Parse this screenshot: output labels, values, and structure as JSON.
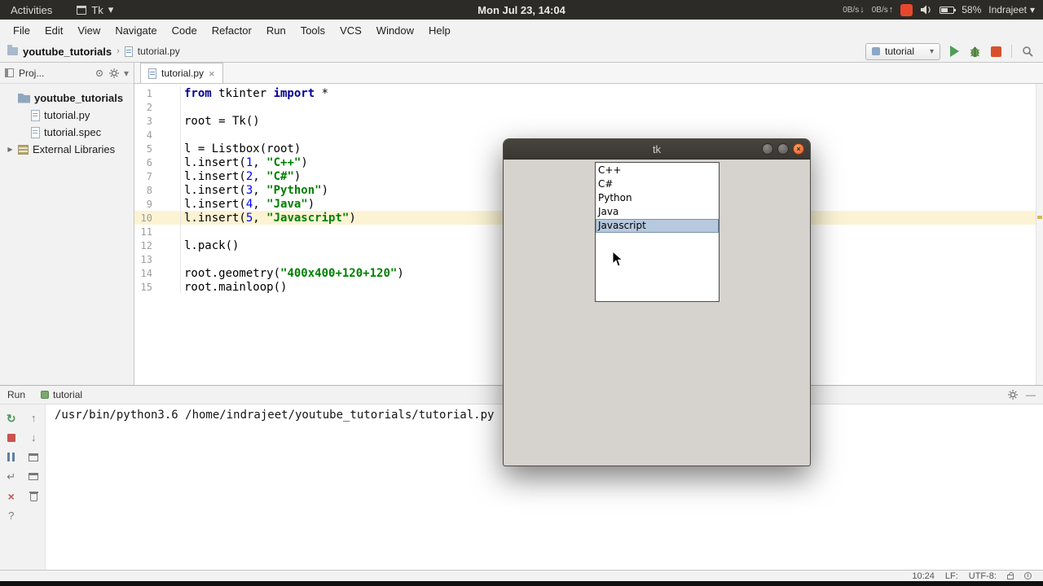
{
  "top_bar": {
    "activities": "Activities",
    "window_name": "Tk",
    "clock": "Mon Jul 23, 14:04",
    "net_down": "0B/s",
    "net_up": "0B/s",
    "battery_percent": "58%",
    "user": "Indrajeet"
  },
  "menu_bar": {
    "items": [
      "File",
      "Edit",
      "View",
      "Navigate",
      "Code",
      "Refactor",
      "Run",
      "Tools",
      "VCS",
      "Window",
      "Help"
    ]
  },
  "nav_bar": {
    "breadcrumb": [
      "youtube_tutorials",
      "tutorial.py"
    ],
    "run_config": "tutorial"
  },
  "project_panel": {
    "header_label": "Proj...",
    "tree": [
      {
        "label": "youtube_tutorials",
        "icon": "folder",
        "bold": true,
        "indent": 0,
        "arrow": ""
      },
      {
        "label": "tutorial.py",
        "icon": "file",
        "bold": false,
        "indent": 1,
        "arrow": ""
      },
      {
        "label": "tutorial.spec",
        "icon": "file",
        "bold": false,
        "indent": 1,
        "arrow": ""
      },
      {
        "label": "External Libraries",
        "icon": "library",
        "bold": false,
        "indent": 0,
        "arrow": "▶"
      }
    ]
  },
  "editor": {
    "tab_label": "tutorial.py",
    "lines": [
      {
        "num": 1,
        "hl": false,
        "segs": [
          [
            "from",
            "k"
          ],
          [
            " tkinter ",
            "p"
          ],
          [
            "import",
            "k"
          ],
          [
            " *",
            "p"
          ]
        ]
      },
      {
        "num": 2,
        "hl": false,
        "segs": []
      },
      {
        "num": 3,
        "hl": false,
        "segs": [
          [
            "root = Tk()",
            "p"
          ]
        ]
      },
      {
        "num": 4,
        "hl": false,
        "segs": []
      },
      {
        "num": 5,
        "hl": false,
        "segs": [
          [
            "l = Listbox(root)",
            "p"
          ]
        ]
      },
      {
        "num": 6,
        "hl": false,
        "segs": [
          [
            "l.insert(",
            "p"
          ],
          [
            "1",
            "n"
          ],
          [
            ", ",
            "p"
          ],
          [
            "\"C++\"",
            "s"
          ],
          [
            ")",
            "p"
          ]
        ]
      },
      {
        "num": 7,
        "hl": false,
        "segs": [
          [
            "l.insert(",
            "p"
          ],
          [
            "2",
            "n"
          ],
          [
            ", ",
            "p"
          ],
          [
            "\"C#\"",
            "s"
          ],
          [
            ")",
            "p"
          ]
        ]
      },
      {
        "num": 8,
        "hl": false,
        "segs": [
          [
            "l.insert(",
            "p"
          ],
          [
            "3",
            "n"
          ],
          [
            ", ",
            "p"
          ],
          [
            "\"Python\"",
            "s"
          ],
          [
            ")",
            "p"
          ]
        ]
      },
      {
        "num": 9,
        "hl": false,
        "segs": [
          [
            "l.insert(",
            "p"
          ],
          [
            "4",
            "n"
          ],
          [
            ", ",
            "p"
          ],
          [
            "\"Java\"",
            "s"
          ],
          [
            ")",
            "p"
          ]
        ]
      },
      {
        "num": 10,
        "hl": true,
        "segs": [
          [
            "l.insert(",
            "p"
          ],
          [
            "5",
            "n"
          ],
          [
            ", ",
            "p"
          ],
          [
            "\"Javascript\"",
            "s"
          ],
          [
            ")",
            "p"
          ]
        ]
      },
      {
        "num": 11,
        "hl": false,
        "segs": []
      },
      {
        "num": 12,
        "hl": false,
        "segs": [
          [
            "l.pack()",
            "p"
          ]
        ]
      },
      {
        "num": 13,
        "hl": false,
        "segs": []
      },
      {
        "num": 14,
        "hl": false,
        "segs": [
          [
            "root.geometry(",
            "p"
          ],
          [
            "\"400x400+120+120\"",
            "s"
          ],
          [
            ")",
            "p"
          ]
        ]
      },
      {
        "num": 15,
        "hl": false,
        "segs": [
          [
            "root.mainloop()",
            "p"
          ]
        ]
      }
    ]
  },
  "run_panel": {
    "panel_label": "Run",
    "tab_label": "tutorial",
    "console_line": "/usr/bin/python3.6 /home/indrajeet/youtube_tutorials/tutorial.py"
  },
  "status_bar": {
    "position": "10:24",
    "line_sep": "LF:",
    "encoding": "UTF-8:"
  },
  "tk_window": {
    "title": "tk",
    "listbox_items": [
      "C++",
      "C#",
      "Python",
      "Java",
      "Javascript"
    ],
    "selected_index": 4
  },
  "icons": {
    "caret_down": "▾",
    "breadcrumb_sep": "›",
    "download_arrow": "↓",
    "upload_arrow": "↑",
    "rerun": "↻",
    "soft_wrap": "↵",
    "close_x": "×",
    "help": "?",
    "up_arrow": "↑",
    "down_arrow": "↓",
    "minimize": "—",
    "tk_close": "×"
  },
  "colors": {
    "ubuntu_bar_bg": "#2c2b27",
    "accent_orange": "#e8472e",
    "keyword": "#000096",
    "string": "#008000",
    "number": "#0000ff",
    "line_highlight": "#fbf3d3",
    "listbox_selection": "#b6c9de"
  }
}
